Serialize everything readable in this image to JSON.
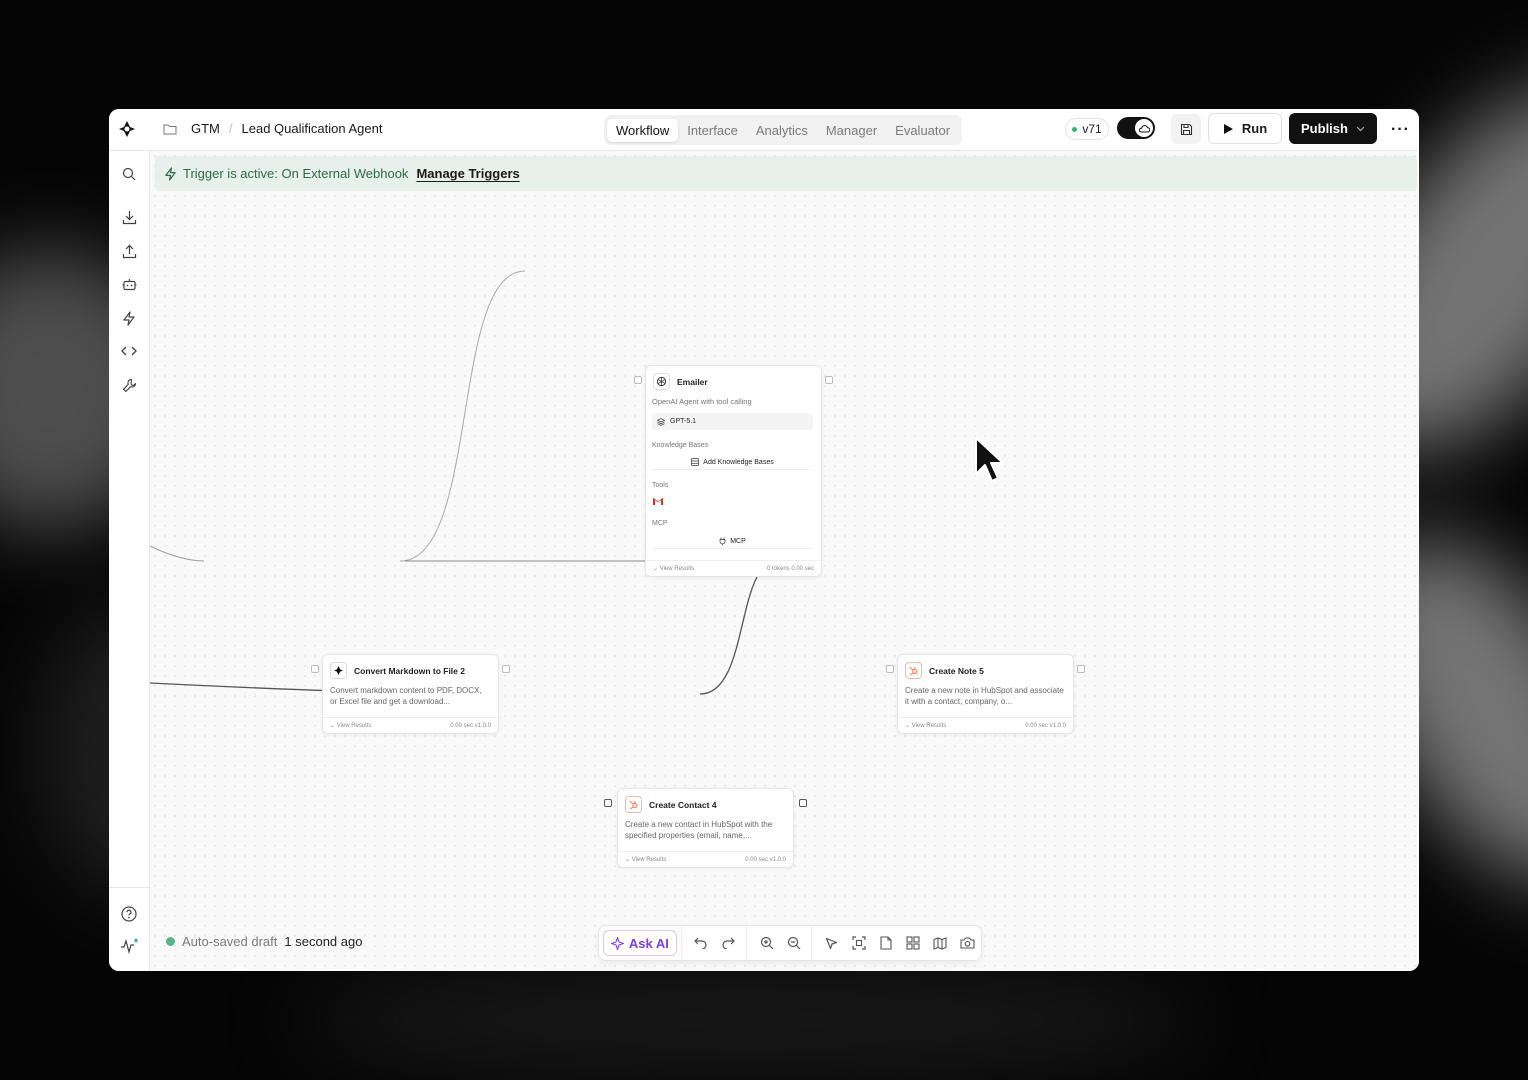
{
  "breadcrumb": {
    "folder": "GTM",
    "project": "Lead Qualification Agent"
  },
  "tabs": [
    {
      "label": "Workflow",
      "active": true
    },
    {
      "label": "Interface",
      "active": false
    },
    {
      "label": "Analytics",
      "active": false
    },
    {
      "label": "Manager",
      "active": false
    },
    {
      "label": "Evaluator",
      "active": false
    }
  ],
  "version": {
    "label": "v71",
    "status_color": "#3bb273"
  },
  "toggle": {
    "on": true
  },
  "actions": {
    "run": "Run",
    "publish": "Publish"
  },
  "trigger": {
    "prefix": "Trigger is active: On External Webhook",
    "manage": "Manage Triggers"
  },
  "nodes": {
    "emailer": {
      "title": "Emailer",
      "subtitle": "OpenAI Agent with tool calling",
      "model": "GPT-5.1",
      "kb_label": "Knowledge Bases",
      "kb_button": "Add Knowledge Bases",
      "tools_label": "Tools",
      "mcp_label": "MCP",
      "mcp_button": "MCP",
      "view_results": "View Results",
      "meta": "0 tokens   0.00 sec"
    },
    "convert": {
      "title": "Convert Markdown to File 2",
      "desc": "Convert markdown content to PDF, DOCX, or Excel file and get a download...",
      "view_results": "View Results",
      "meta": "0.00 sec  v1.0.0"
    },
    "note": {
      "title": "Create Note 5",
      "desc": "Create a new note in HubSpot and associate it with a contact, company, o...",
      "view_results": "View Results",
      "meta": "0.00 sec  v1.0.0"
    },
    "contact": {
      "title": "Create Contact 4",
      "desc": "Create a new contact in HubSpot with the specified properties (email, name,...",
      "view_results": "View Results",
      "meta": "0.00 sec  v1.0.0"
    }
  },
  "status": {
    "text": "Auto-saved draft",
    "time": "1 second ago",
    "color": "#52b788"
  },
  "toolbar": {
    "ask_ai": "Ask AI",
    "accent": "#7b3fe4"
  },
  "colors": {
    "trigger_bg": "#e7f0ea",
    "trigger_text": "#2d6a45",
    "hubspot": "#ff7a59"
  }
}
